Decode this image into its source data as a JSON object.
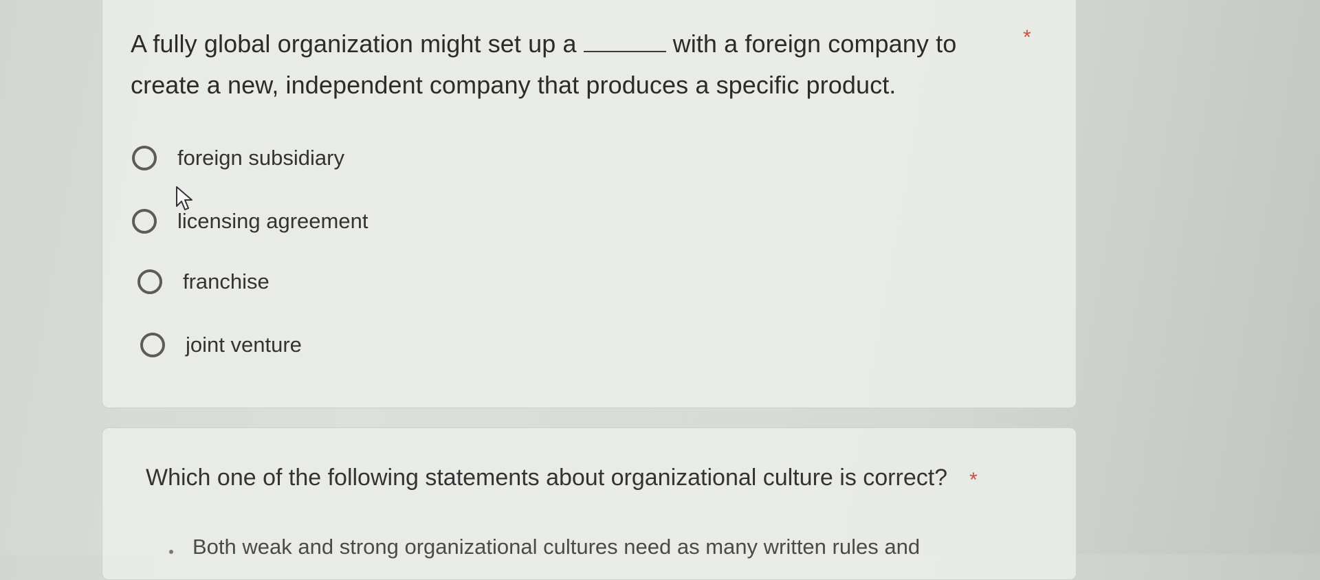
{
  "question_1": {
    "text_before_blank": "A fully global organization might set up a",
    "text_after_blank": "with a foreign company to create a new, independent company that produces a specific product.",
    "required_marker": "*",
    "options": [
      {
        "label": "foreign subsidiary"
      },
      {
        "label": "licensing agreement"
      },
      {
        "label": "franchise"
      },
      {
        "label": "joint venture"
      }
    ]
  },
  "question_2": {
    "text": "Which one of the following statements about organizational culture is correct?",
    "required_marker": "*",
    "partial_option_text": "Both weak and strong organizational cultures need as many written rules and"
  },
  "colors": {
    "required_star": "#c6524a",
    "radio_border": "#5b5b5b"
  },
  "icons": {
    "pointer": "mouse-pointer-icon"
  }
}
